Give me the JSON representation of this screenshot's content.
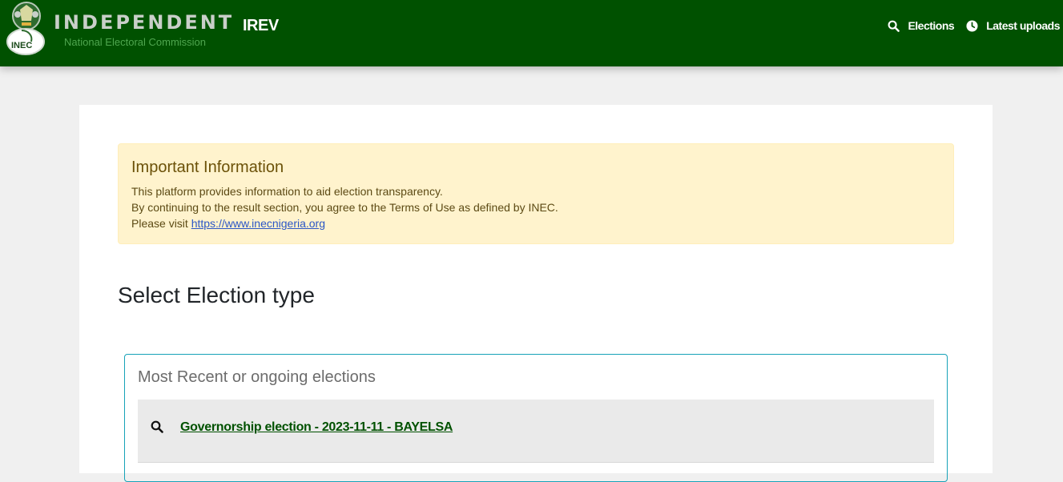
{
  "header": {
    "brand_name": "INDEPENDENT",
    "brand_subtitle": "National Electoral Commission",
    "badge_text": "INEC",
    "app_title": "IREV",
    "nav": [
      {
        "label": "Elections",
        "icon": "search-icon"
      },
      {
        "label": "Latest uploads",
        "icon": "clock-icon"
      }
    ]
  },
  "notice": {
    "title": "Important Information",
    "line1": "This platform provides information to aid election transparency.",
    "line2": "By continuing to the result section, you agree to the Terms of Use as defined by INEC.",
    "line3_prefix": "Please visit ",
    "link": "https://www.inecnigeria.org"
  },
  "main": {
    "section_title": "Select Election type",
    "recent_title": "Most Recent or ongoing elections",
    "elections": [
      {
        "label": "Governorship election - 2023-11-11 - BAYELSA",
        "icon": "search-icon"
      }
    ]
  },
  "colors": {
    "navbar": "#005100",
    "alert_bg": "#fff3cd",
    "box_border": "#17a2b8",
    "link_green": "#005100"
  }
}
